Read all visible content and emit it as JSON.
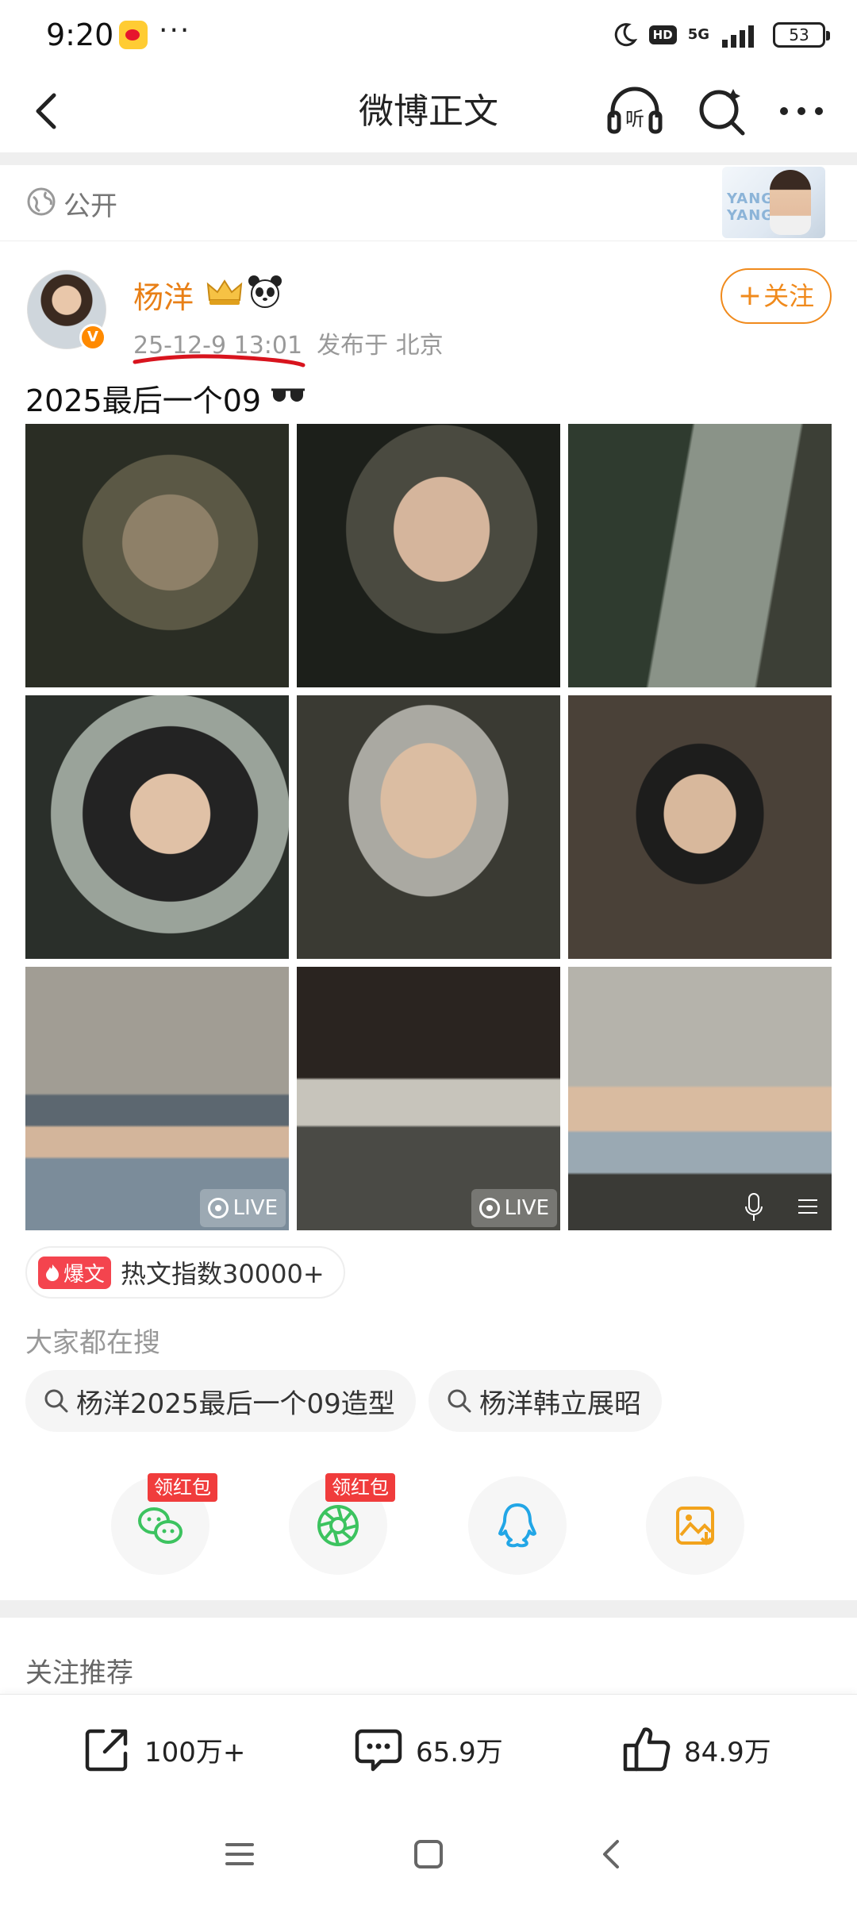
{
  "status_bar": {
    "time": "9:20",
    "dots": "···",
    "hd": "HD",
    "network": "5G",
    "battery": "53"
  },
  "nav": {
    "title": "微博正文",
    "icons": [
      "back-arrow-icon",
      "headphones-listen-icon",
      "search-icon",
      "more-icon"
    ]
  },
  "visibility": {
    "label": "公开",
    "banner_text": "YANG YANG"
  },
  "author": {
    "name": "杨洋",
    "verified_badge": "V",
    "timestamp": "25-12-9 13:01",
    "location": "发布于 北京",
    "follow_label": "关注"
  },
  "post": {
    "text": "2025最后一个09",
    "photos_count_visible": 9,
    "live_label": "LIVE"
  },
  "hot": {
    "tag": "爆文",
    "text": "热文指数30000+"
  },
  "searches": {
    "label": "大家都在搜",
    "items": [
      "杨洋2025最后一个09造型",
      "杨洋韩立展昭"
    ]
  },
  "share": {
    "red_packet_label": "领红包",
    "targets": [
      "wechat-icon",
      "moments-icon",
      "qq-icon",
      "save-image-icon"
    ]
  },
  "recommend": {
    "label": "关注推荐"
  },
  "actions": {
    "repost": "100万+",
    "comment": "65.9万",
    "like": "84.9万"
  },
  "colors": {
    "accent_orange": "#e87f16",
    "red": "#f03c3c",
    "hot_red": "#f4444e"
  }
}
